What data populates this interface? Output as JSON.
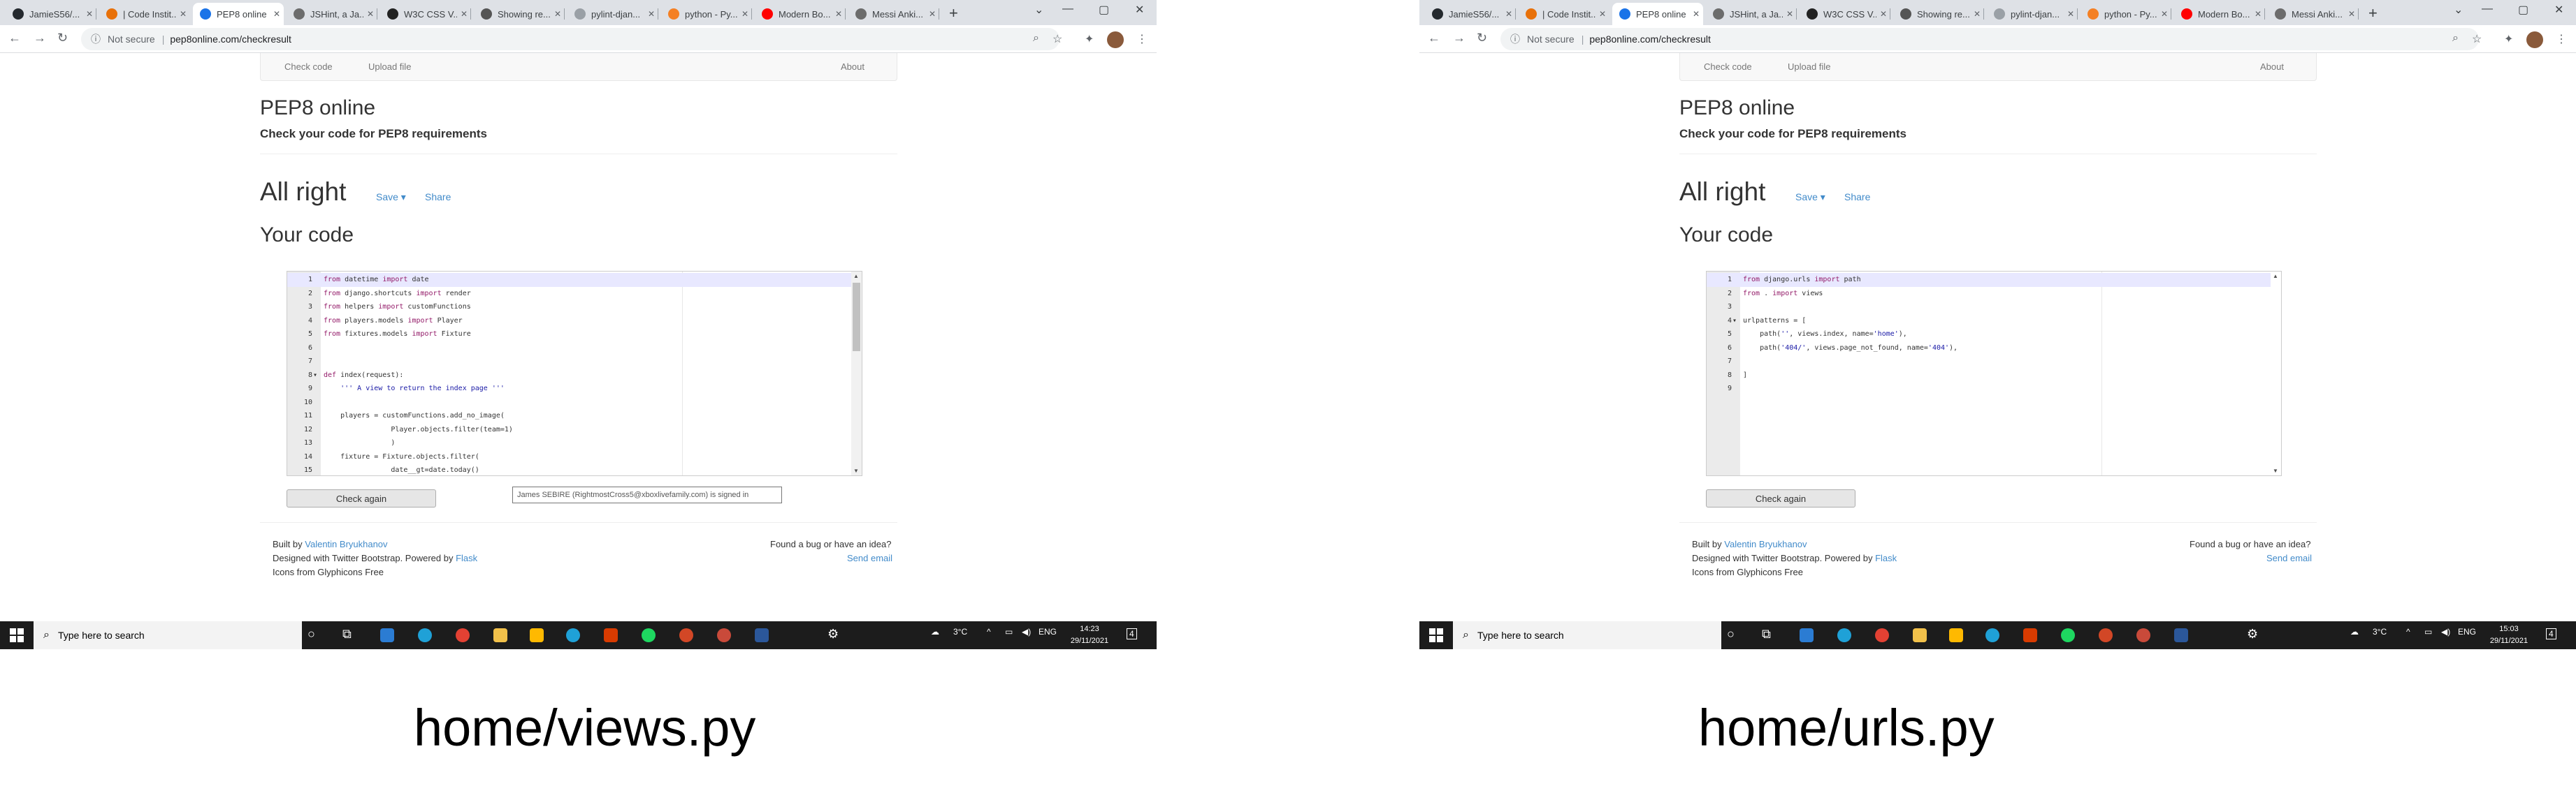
{
  "left": {
    "tabs": [
      "JamieS56/...",
      "| Code Instit...",
      "PEP8 online",
      "JSHint, a Ja...",
      "W3C CSS V...",
      "Showing re...",
      "pylint-djan...",
      "python - Py...",
      "Modern Bo...",
      "Messi Anki..."
    ],
    "address": {
      "security": "Not secure",
      "url": "pep8online.com/checkresult"
    },
    "site_nav": {
      "check_code": "Check code",
      "upload_file": "Upload file",
      "about": "About"
    },
    "brand": "PEP8 online",
    "subtitle": "Check your code for PEP8 requirements",
    "result": "All right",
    "save": "Save",
    "share": "Share",
    "your_code": "Your code",
    "lines": [
      {
        "n": "1",
        "t": "from datetime import date"
      },
      {
        "n": "2",
        "t": "from django.shortcuts import render"
      },
      {
        "n": "3",
        "t": "from helpers import customFunctions"
      },
      {
        "n": "4",
        "t": "from players.models import Player"
      },
      {
        "n": "5",
        "t": "from fixtures.models import Fixture"
      },
      {
        "n": "6",
        "t": ""
      },
      {
        "n": "7",
        "t": ""
      },
      {
        "n": "8",
        "t": "def index(request):"
      },
      {
        "n": "9",
        "t": "    ''' A view to return the index page '''"
      },
      {
        "n": "10",
        "t": ""
      },
      {
        "n": "11",
        "t": "    players = customFunctions.add_no_image("
      },
      {
        "n": "12",
        "t": "                Player.objects.filter(team=1)"
      },
      {
        "n": "13",
        "t": "                )"
      },
      {
        "n": "14",
        "t": "    fixture = Fixture.objects.filter("
      },
      {
        "n": "15",
        "t": "                date__gt=date.today()"
      }
    ],
    "check_again": "Check again",
    "tooltip": "James SEBIRE (RightmostCross5@xboxlivefamily.com) is signed in",
    "footer": {
      "built_by": "Built by",
      "author": "Valentin Bryukhanov",
      "designed": "Designed with Twitter Bootstrap. Powered by",
      "flask": "Flask",
      "icons": "Icons from Glyphicons Free",
      "bug": "Found a bug or have an idea?",
      "send": "Send email"
    },
    "taskbar": {
      "search": "Type here to search",
      "temp": "3°C",
      "lang": "ENG",
      "time": "14:23",
      "date": "29/11/2021",
      "notif": "4"
    }
  },
  "right": {
    "tabs": [
      "JamieS56/...",
      "| Code Instit...",
      "PEP8 online",
      "JSHint, a Ja...",
      "W3C CSS V...",
      "Showing re...",
      "pylint-djan...",
      "python - Py...",
      "Modern Bo...",
      "Messi Anki..."
    ],
    "address": {
      "security": "Not secure",
      "url": "pep8online.com/checkresult"
    },
    "site_nav": {
      "check_code": "Check code",
      "upload_file": "Upload file",
      "about": "About"
    },
    "brand": "PEP8 online",
    "subtitle": "Check your code for PEP8 requirements",
    "result": "All right",
    "save": "Save",
    "share": "Share",
    "your_code": "Your code",
    "lines": [
      {
        "n": "1",
        "t": "from django.urls import path"
      },
      {
        "n": "2",
        "t": "from . import views"
      },
      {
        "n": "3",
        "t": ""
      },
      {
        "n": "4",
        "t": "urlpatterns = ["
      },
      {
        "n": "5",
        "t": "    path('', views.index, name='home'),"
      },
      {
        "n": "6",
        "t": "    path('404/', views.page_not_found, name='404'),"
      },
      {
        "n": "7",
        "t": ""
      },
      {
        "n": "8",
        "t": "]"
      },
      {
        "n": "9",
        "t": ""
      }
    ],
    "check_again": "Check again",
    "footer": {
      "built_by": "Built by",
      "author": "Valentin Bryukhanov",
      "designed": "Designed with Twitter Bootstrap. Powered by",
      "flask": "Flask",
      "icons": "Icons from Glyphicons Free",
      "bug": "Found a bug or have an idea?",
      "send": "Send email"
    },
    "taskbar": {
      "search": "Type here to search",
      "temp": "3°C",
      "lang": "ENG",
      "time": "15:03",
      "date": "29/11/2021",
      "notif": "4"
    }
  },
  "captions": {
    "left": "home/views.py",
    "right": "home/urls.py"
  },
  "colors": {
    "link": "#428bca",
    "keyword": "#931a68",
    "string": "#1a1aa6",
    "taskbar": "#1c1c1c"
  }
}
